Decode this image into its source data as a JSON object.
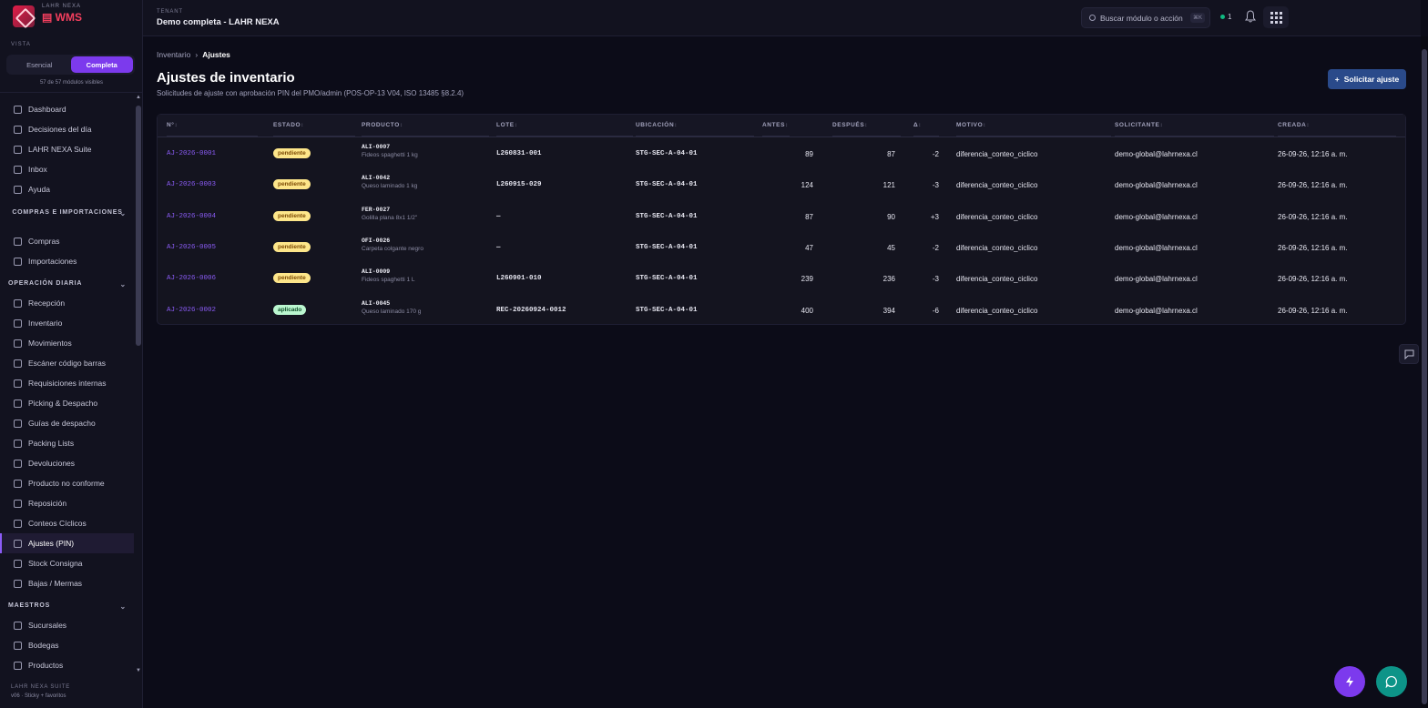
{
  "brand": {
    "kicker": "LAHR NEXA",
    "name": "WMS"
  },
  "vista": {
    "label": "VISTA",
    "options": [
      "Esencial",
      "Completa"
    ],
    "selected": "Completa",
    "count": "57 de 57 módulos visibles"
  },
  "nav": {
    "top": [
      "Dashboard",
      "Decisiones del día",
      "LAHR NEXA Suite",
      "Inbox",
      "Ayuda"
    ],
    "compras_title": "COMPRAS E IMPORTACIONES",
    "compras": [
      "Compras",
      "Importaciones"
    ],
    "operacion_title": "OPERACIÓN DIARIA",
    "operacion": [
      "Recepción",
      "Inventario",
      "Movimientos",
      "Escáner código barras",
      "Requisiciones internas",
      "Picking & Despacho",
      "Guías de despacho",
      "Packing Lists",
      "Devoluciones",
      "Producto no conforme",
      "Reposición",
      "Conteos Cíclicos",
      "Ajustes (PIN)",
      "Stock Consigna",
      "Bajas / Mermas"
    ],
    "maestros_title": "MAESTROS",
    "maestros": [
      "Sucursales",
      "Bodegas",
      "Productos"
    ],
    "active": "Ajustes (PIN)"
  },
  "footer": {
    "kicker": "LAHR NEXA SUITE",
    "version": "v06 · Sticky + favoritos"
  },
  "topbar": {
    "tenant_label": "TENANT",
    "tenant_name": "Demo completa - LAHR NEXA",
    "search_placeholder": "Buscar módulo o acción",
    "search_shortcut": "⌘K",
    "status_count": "1"
  },
  "breadcrumb": {
    "parent": "Inventario",
    "current": "Ajustes"
  },
  "page": {
    "title": "Ajustes de inventario",
    "subtitle": "Solicitudes de ajuste con aprobación PIN del PMO/admin (POS-OP-13 V04, ISO 13485 §8.2.4)",
    "button": "Solicitar ajuste"
  },
  "table": {
    "columns": [
      "N°",
      "ESTADO",
      "PRODUCTO",
      "LOTE",
      "UBICACIÓN",
      "ANTES",
      "DESPUÉS",
      "Δ",
      "MOTIVO",
      "SOLICITANTE",
      "CREADA"
    ],
    "rows": [
      {
        "id": "AJ-2026-0001",
        "estado": "pendiente",
        "sku": "ALI-0007",
        "desc": "Fideos spaghetti 1 kg",
        "lote": "L260831-001",
        "ubic": "STG-SEC-A-04-01",
        "antes": "89",
        "despues": "87",
        "delta": "-2",
        "motivo": "diferencia_conteo_ciclico",
        "solicitante": "demo-global@lahrnexa.cl",
        "creada": "26-09-26, 12:16 a. m."
      },
      {
        "id": "AJ-2026-0003",
        "estado": "pendiente",
        "sku": "ALI-0042",
        "desc": "Queso laminado 1 kg",
        "lote": "L260915-029",
        "ubic": "STG-SEC-A-04-01",
        "antes": "124",
        "despues": "121",
        "delta": "-3",
        "motivo": "diferencia_conteo_ciclico",
        "solicitante": "demo-global@lahrnexa.cl",
        "creada": "26-09-26, 12:16 a. m."
      },
      {
        "id": "AJ-2026-0004",
        "estado": "pendiente",
        "sku": "FER-0027",
        "desc": "Golilla plana 8x1 1/2\"",
        "lote": "—",
        "ubic": "STG-SEC-A-04-01",
        "antes": "87",
        "despues": "90",
        "delta": "+3",
        "motivo": "diferencia_conteo_ciclico",
        "solicitante": "demo-global@lahrnexa.cl",
        "creada": "26-09-26, 12:16 a. m."
      },
      {
        "id": "AJ-2026-0005",
        "estado": "pendiente",
        "sku": "OFI-0026",
        "desc": "Carpeta colgante negro",
        "lote": "—",
        "ubic": "STG-SEC-A-04-01",
        "antes": "47",
        "despues": "45",
        "delta": "-2",
        "motivo": "diferencia_conteo_ciclico",
        "solicitante": "demo-global@lahrnexa.cl",
        "creada": "26-09-26, 12:16 a. m."
      },
      {
        "id": "AJ-2026-0006",
        "estado": "pendiente",
        "sku": "ALI-0009",
        "desc": "Fideos spaghetti 1 L",
        "lote": "L260901-010",
        "ubic": "STG-SEC-A-04-01",
        "antes": "239",
        "despues": "236",
        "delta": "-3",
        "motivo": "diferencia_conteo_ciclico",
        "solicitante": "demo-global@lahrnexa.cl",
        "creada": "26-09-26, 12:16 a. m."
      },
      {
        "id": "AJ-2026-0002",
        "estado": "aplicado",
        "sku": "ALI-0045",
        "desc": "Queso laminado 170 g",
        "lote": "REC-20260924-0012",
        "ubic": "STG-SEC-A-04-01",
        "antes": "400",
        "despues": "394",
        "delta": "-6",
        "motivo": "diferencia_conteo_ciclico",
        "solicitante": "demo-global@lahrnexa.cl",
        "creada": "26-09-26, 12:16 a. m."
      }
    ]
  },
  "colors": {
    "accent": "#7c3aed",
    "link": "#8b5cf6",
    "pending": "#fde68a",
    "applied": "#bbf7d0",
    "primary_button": "#2a4a8a"
  }
}
